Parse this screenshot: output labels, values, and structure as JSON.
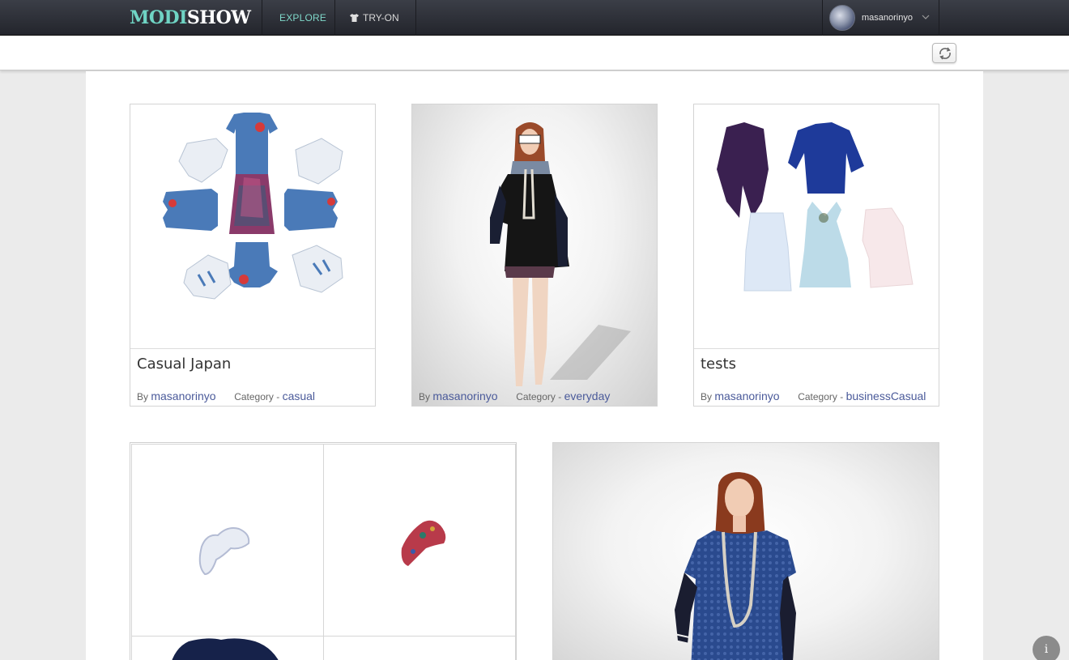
{
  "header": {
    "logo_part1": "MODI",
    "logo_part2": "SHOW",
    "nav": {
      "explore": "EXPLORE",
      "tryon": "TRY-ON"
    },
    "user": {
      "name": "masanorinyo"
    }
  },
  "cards": [
    {
      "title": "Casual Japan",
      "by_label": "By",
      "author": "masanorinyo",
      "category_label": "Category - ",
      "category": "casual"
    },
    {
      "title": "",
      "by_label": "By",
      "author": "masanorinyo",
      "category_label": "Category - ",
      "category": "everyday"
    },
    {
      "title": "tests",
      "by_label": "By",
      "author": "masanorinyo",
      "category_label": "Category - ",
      "category": "businessCasual"
    }
  ],
  "info_button": {
    "label": "i"
  },
  "colors": {
    "accent": "#7fd8c9",
    "link": "#4a5a9a",
    "topbar": "#2b2d35"
  },
  "icons": [
    "shirt-icon",
    "chevron-down-icon",
    "refresh-icon",
    "info-icon"
  ]
}
